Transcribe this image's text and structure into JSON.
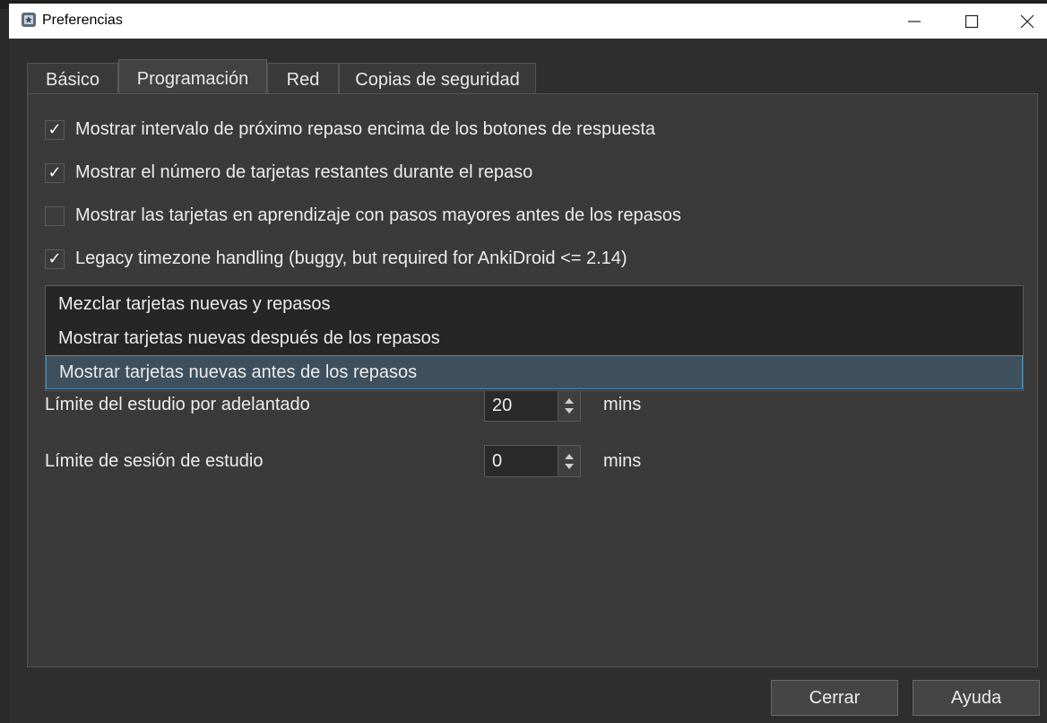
{
  "window": {
    "title": "Preferencias",
    "controls": {
      "minimize": "minimize-icon",
      "maximize": "maximize-icon",
      "close": "close-icon"
    }
  },
  "tabs": [
    {
      "label": "Básico",
      "active": false
    },
    {
      "label": "Programación",
      "active": true
    },
    {
      "label": "Red",
      "active": false
    },
    {
      "label": "Copias de seguridad",
      "active": false
    }
  ],
  "options": [
    {
      "label": "Mostrar intervalo de próximo repaso encima de los botones de respuesta",
      "checked": true
    },
    {
      "label": "Mostrar el número de tarjetas restantes durante el repaso",
      "checked": true
    },
    {
      "label": "Mostrar las tarjetas en aprendizaje con pasos mayores antes de los repasos",
      "checked": false
    },
    {
      "label": "Legacy timezone handling (buggy, but required for AnkiDroid <= 2.14)",
      "checked": true
    }
  ],
  "dropdown": {
    "options": [
      "Mezclar tarjetas nuevas y repasos",
      "Mostrar tarjetas nuevas después de los repasos",
      "Mostrar tarjetas nuevas antes de los repasos"
    ],
    "selected": "Mostrar tarjetas nuevas antes de los repasos"
  },
  "limits": [
    {
      "label": "Límite del estudio por adelantado",
      "value": "20",
      "unit": "mins"
    },
    {
      "label": "Límite de sesión de estudio",
      "value": "0",
      "unit": "mins"
    }
  ],
  "buttons": {
    "close": "Cerrar",
    "help": "Ayuda"
  },
  "colors": {
    "background": "#2e2e2e",
    "panel": "#3a3a3a",
    "selection": "#3e505d",
    "selection_border": "#4f8fbf"
  }
}
